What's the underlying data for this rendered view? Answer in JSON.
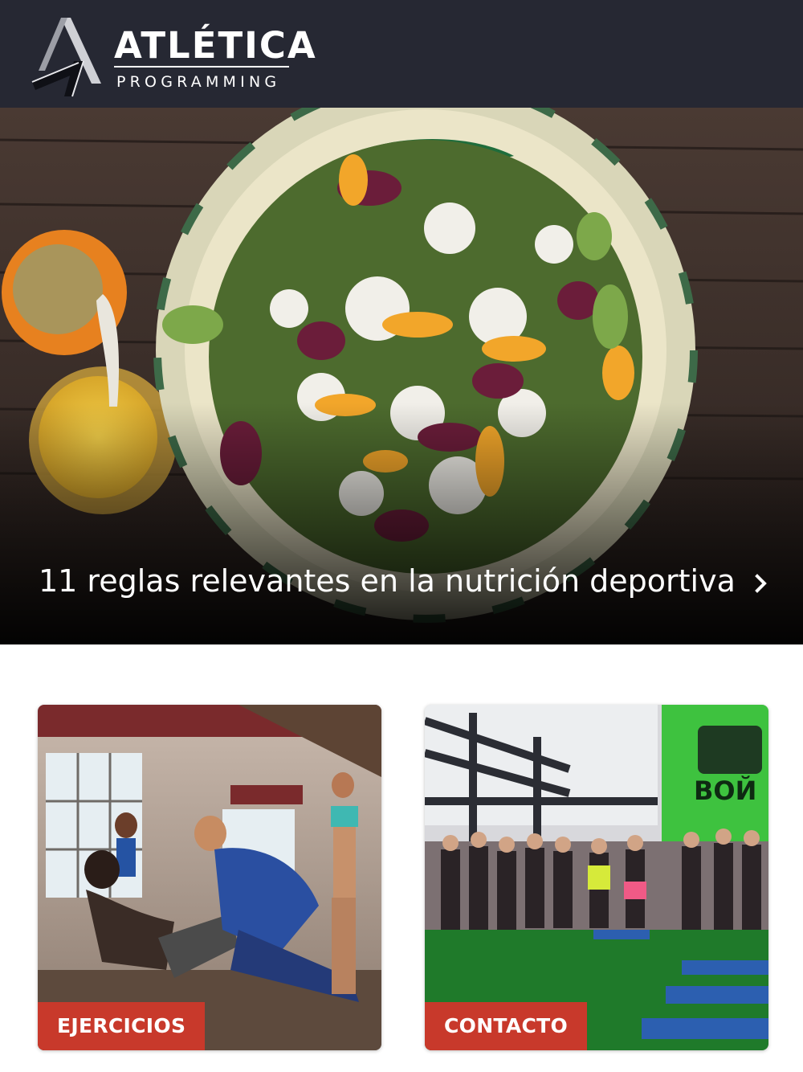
{
  "header": {
    "brand_title": "ATLÉTICA",
    "brand_subtitle": "PROGRAMMING",
    "logo_icon": "atletica-logo-icon"
  },
  "hero": {
    "title": "11 reglas relevantes en la nutrición deportiva",
    "arrow_icon": "chevron-right-icon",
    "image_subject": "salad-bowl-photo"
  },
  "cards": [
    {
      "label": "EJERCICIOS",
      "image_subject": "gym-workout-photo"
    },
    {
      "label": "CONTACTO",
      "image_subject": "gym-group-photo"
    }
  ],
  "colors": {
    "header_bg": "#262833",
    "label_bg": "#c8392b",
    "text": "#ffffff",
    "page_bg": "#ffffff"
  }
}
